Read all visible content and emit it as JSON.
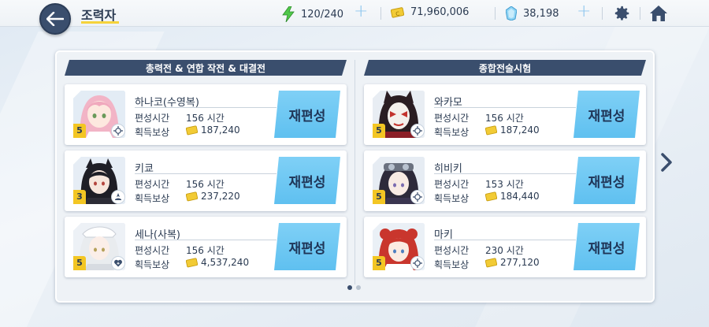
{
  "header": {
    "title": "조력자",
    "ap": "120/240",
    "credits": "71,960,006",
    "pyroxene": "38,198"
  },
  "columns": [
    {
      "title": "총력전 & 연합 작전 & 대결전"
    },
    {
      "title": "종합전술시험"
    }
  ],
  "labels": {
    "time": "편성시간",
    "reward": "획득보상",
    "reform": "재편성"
  },
  "cards": [
    {
      "name": "하나코(수영복)",
      "time": "156 시간",
      "reward": "187,240",
      "stars": "5",
      "role": "special"
    },
    {
      "name": "키쿄",
      "time": "156 시간",
      "reward": "237,220",
      "stars": "3",
      "role": "support"
    },
    {
      "name": "세나(사복)",
      "time": "156 시간",
      "reward": "4,537,240",
      "stars": "5",
      "role": "healer"
    },
    {
      "name": "와카모",
      "time": "156 시간",
      "reward": "187,240",
      "stars": "5",
      "role": "special"
    },
    {
      "name": "히비키",
      "time": "153 시간",
      "reward": "184,440",
      "stars": "5",
      "role": "special"
    },
    {
      "name": "마키",
      "time": "230 시간",
      "reward": "277,120",
      "stars": "5",
      "role": "special"
    }
  ],
  "colors": {
    "accent": "#3a4e6d",
    "button": "#6ac6f2",
    "highlight": "#f5d33b"
  },
  "pagination": {
    "total": 2,
    "active": 1
  }
}
